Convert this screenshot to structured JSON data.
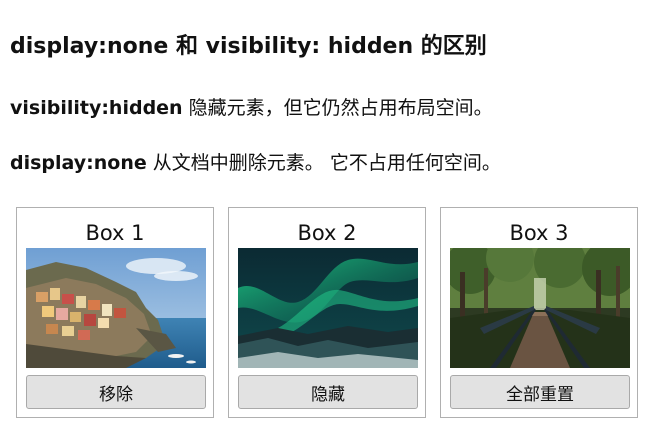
{
  "heading": "display:none 和 visibility: hidden 的区别",
  "visibility_line": {
    "code": "visibility:hidden",
    "text": " 隐藏元素，但它仍然占用布局空间。"
  },
  "display_line": {
    "code": "display:none",
    "text": " 从文档中删除元素。 它不占用任何空间。"
  },
  "boxes": [
    {
      "label": "Box 1",
      "image": "coastal-village-photo",
      "button": "移除"
    },
    {
      "label": "Box 2",
      "image": "aurora-photo",
      "button": "隐藏"
    },
    {
      "label": "Box 3",
      "image": "forest-bridge-photo",
      "button": "全部重置"
    }
  ]
}
